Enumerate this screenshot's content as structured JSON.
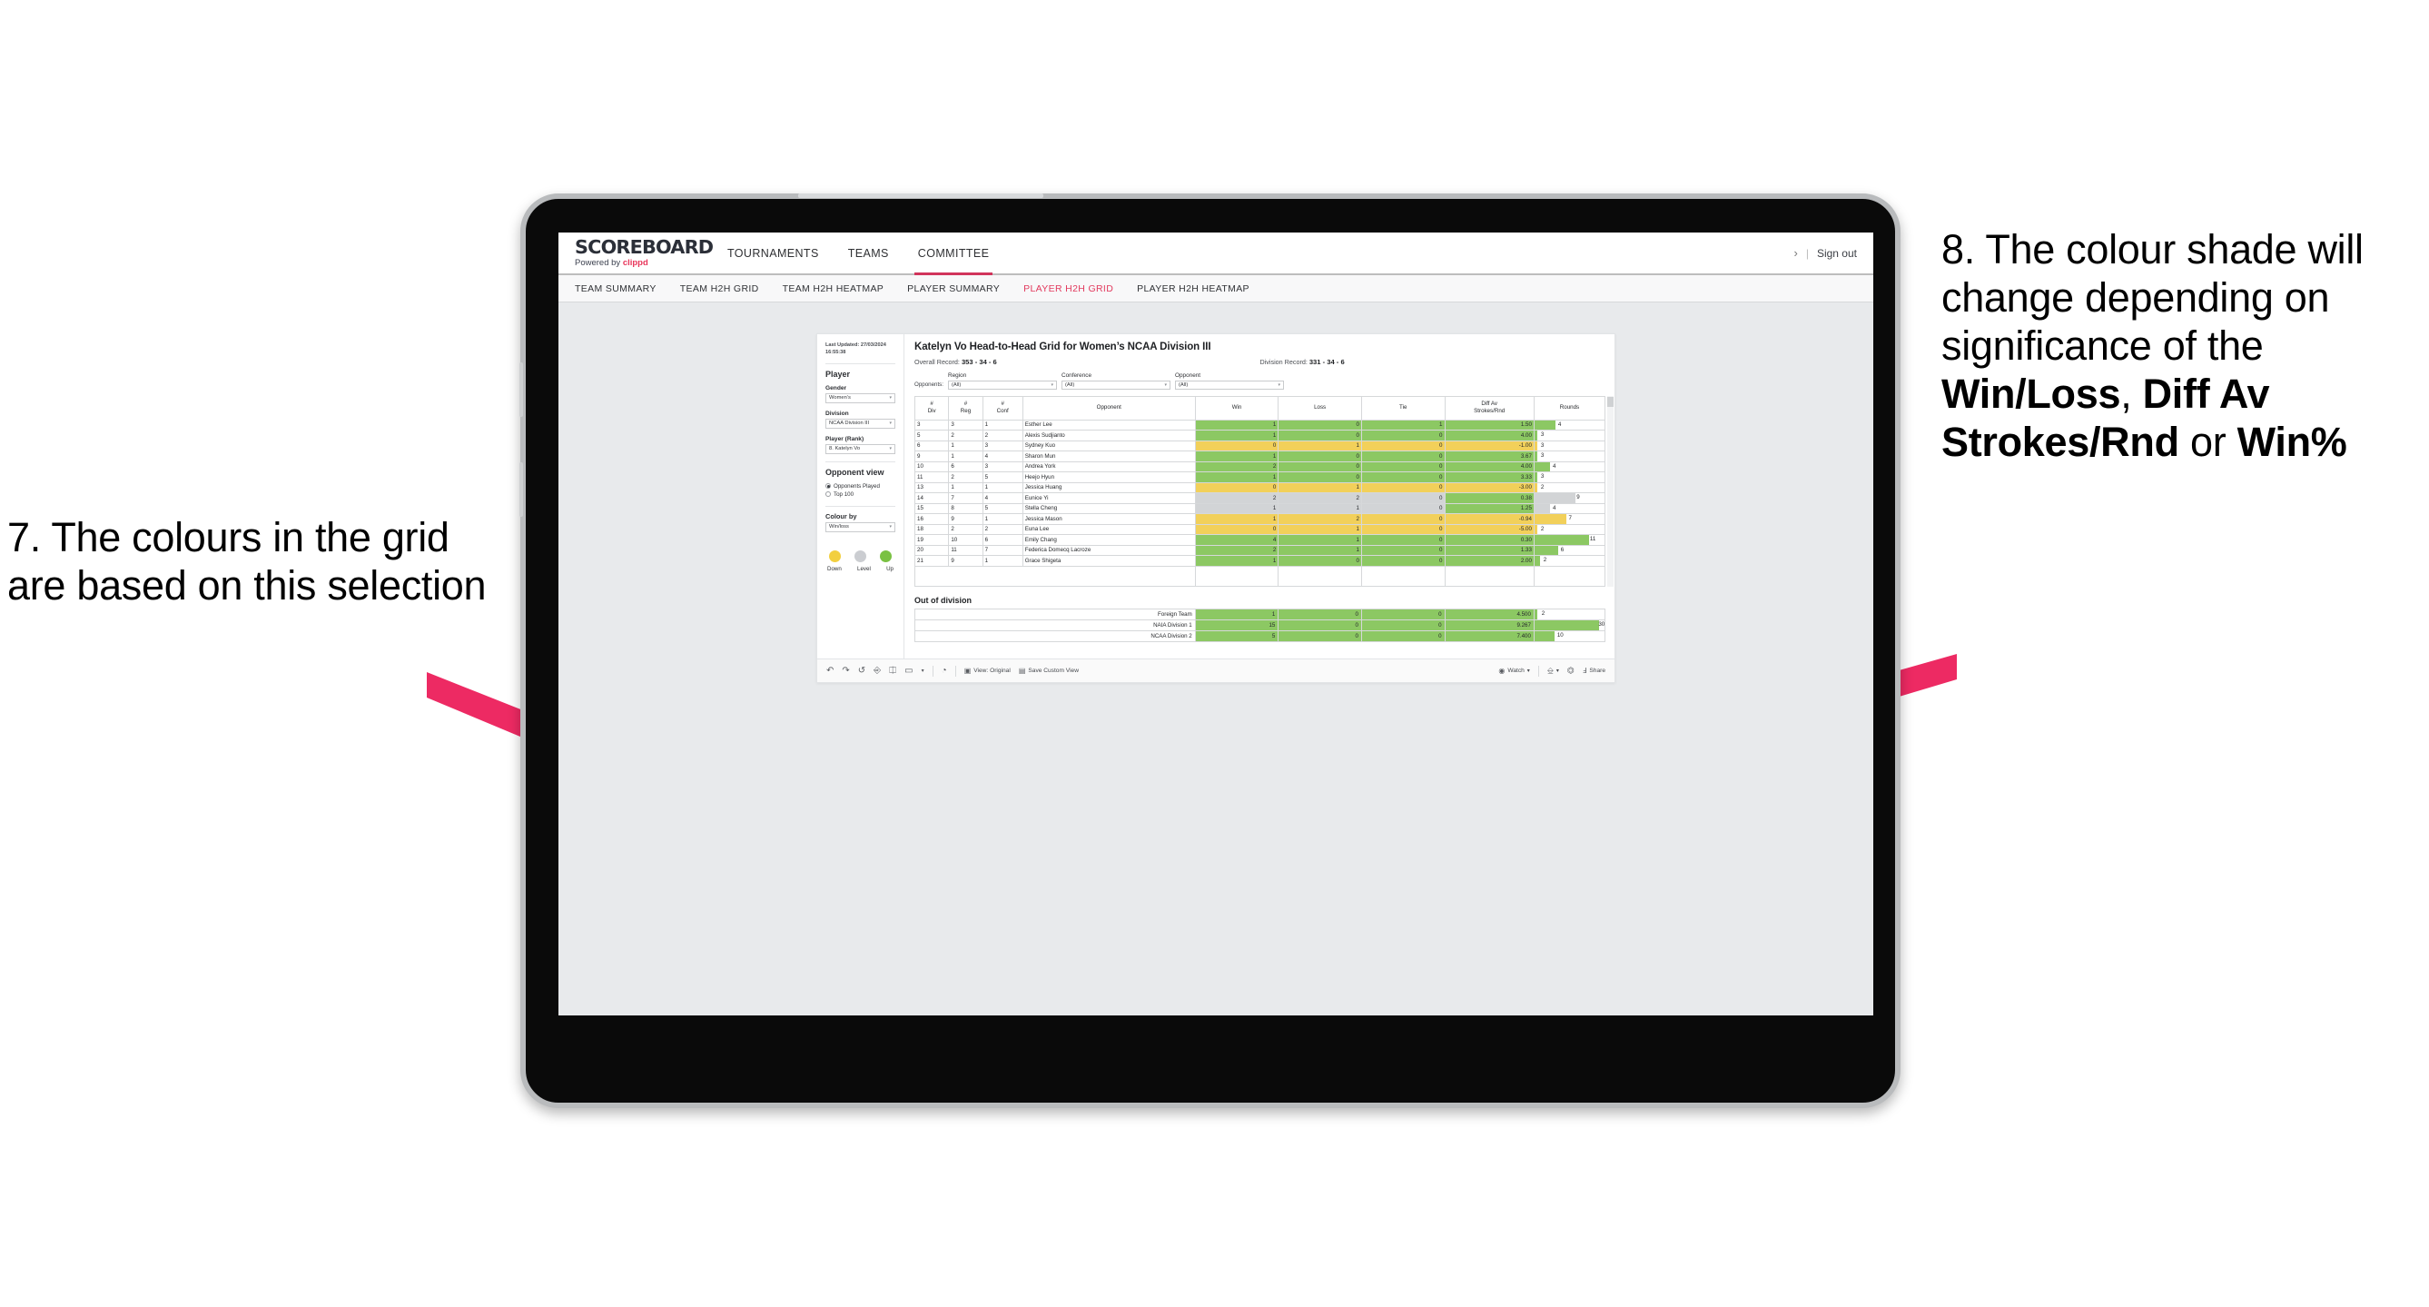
{
  "annotations": {
    "left": {
      "number": "7.",
      "text": "The colours in the grid are based on this selection"
    },
    "right": {
      "number": "8.",
      "part1": "The colour shade will change depending on significance of the ",
      "bold1": "Win/Loss",
      "mid1": ", ",
      "bold2": "Diff Av Strokes/Rnd",
      "mid2": " or ",
      "bold3": "Win%"
    },
    "arrow_color": "#ed2a63"
  },
  "app": {
    "brand": {
      "name": "SCOREBOARD",
      "powered_prefix": "Powered by ",
      "powered_brand": "clippd"
    },
    "topnav": [
      {
        "label": "TOURNAMENTS",
        "active": false
      },
      {
        "label": "TEAMS",
        "active": false
      },
      {
        "label": "COMMITTEE",
        "active": true
      }
    ],
    "topnav_right": {
      "chevron": "›",
      "separator": "|",
      "signout": "Sign out"
    },
    "subnav": [
      {
        "label": "TEAM SUMMARY",
        "active": false
      },
      {
        "label": "TEAM H2H GRID",
        "active": false
      },
      {
        "label": "TEAM H2H HEATMAP",
        "active": false
      },
      {
        "label": "PLAYER SUMMARY",
        "active": false
      },
      {
        "label": "PLAYER H2H GRID",
        "active": true
      },
      {
        "label": "PLAYER H2H HEATMAP",
        "active": false
      }
    ]
  },
  "sidepanel": {
    "last_updated_label": "Last Updated: 27/03/2024",
    "last_updated_time": "16:55:38",
    "section_player": "Player",
    "gender_label": "Gender",
    "gender_value": "Women’s",
    "division_label": "Division",
    "division_value": "NCAA Division III",
    "player_rank_label": "Player (Rank)",
    "player_rank_value": "8. Katelyn Vo",
    "opponent_view_label": "Opponent view",
    "opponent_view_options": [
      {
        "label": "Opponents Played",
        "selected": true
      },
      {
        "label": "Top 100",
        "selected": false
      }
    ],
    "colour_by_label": "Colour by",
    "colour_by_value": "Win/loss",
    "legend": [
      {
        "label": "Down",
        "color": "#f2cf3f"
      },
      {
        "label": "Level",
        "color": "#cbcdd1"
      },
      {
        "label": "Up",
        "color": "#7ac143"
      }
    ]
  },
  "grid": {
    "title": "Katelyn Vo Head-to-Head Grid for Women’s NCAA Division III",
    "overall_record_label": "Overall Record:",
    "overall_record_value": "353 -  34 - 6",
    "division_record_label": "Division Record:",
    "division_record_value": "331 -  34 - 6",
    "opponents_label": "Opponents:",
    "filters": [
      {
        "label": "Region",
        "value": "(All)"
      },
      {
        "label": "Conference",
        "value": "(All)"
      },
      {
        "label": "Opponent",
        "value": "(All)"
      }
    ],
    "columns": [
      {
        "l1": "#",
        "l2": "Div"
      },
      {
        "l1": "#",
        "l2": "Reg"
      },
      {
        "l1": "#",
        "l2": "Conf"
      },
      {
        "l1": "Opponent",
        "l2": ""
      },
      {
        "l1": "Win",
        "l2": ""
      },
      {
        "l1": "Loss",
        "l2": ""
      },
      {
        "l1": "Tie",
        "l2": ""
      },
      {
        "l1": "Diff Av",
        "l2": "Strokes/Rnd"
      },
      {
        "l1": "Rounds",
        "l2": ""
      }
    ],
    "rows": [
      {
        "div": "3",
        "reg": "3",
        "conf": "1",
        "opponent": "Esther Lee",
        "win": "1",
        "loss": "0",
        "tie": "1",
        "diff": "1.50",
        "rounds": "4",
        "color": "#8cc863",
        "bar_pct": 30
      },
      {
        "div": "5",
        "reg": "2",
        "conf": "2",
        "opponent": "Alexis Sudjianto",
        "win": "1",
        "loss": "0",
        "tie": "0",
        "diff": "4.00",
        "rounds": "3",
        "color": "#8cc863",
        "bar_pct": 4
      },
      {
        "div": "6",
        "reg": "1",
        "conf": "3",
        "opponent": "Sydney Kuo",
        "win": "0",
        "loss": "1",
        "tie": "0",
        "diff": "-1.00",
        "rounds": "3",
        "color": "#f2d05a",
        "bar_pct": 4
      },
      {
        "div": "9",
        "reg": "1",
        "conf": "4",
        "opponent": "Sharon Mun",
        "win": "1",
        "loss": "0",
        "tie": "0",
        "diff": "3.67",
        "rounds": "3",
        "color": "#8cc863",
        "bar_pct": 4
      },
      {
        "div": "10",
        "reg": "6",
        "conf": "3",
        "opponent": "Andrea York",
        "win": "2",
        "loss": "0",
        "tie": "0",
        "diff": "4.00",
        "rounds": "4",
        "color": "#8cc863",
        "bar_pct": 22
      },
      {
        "div": "11",
        "reg": "2",
        "conf": "5",
        "opponent": "Heejo Hyun",
        "win": "1",
        "loss": "0",
        "tie": "0",
        "diff": "3.33",
        "rounds": "3",
        "color": "#8cc863",
        "bar_pct": 4
      },
      {
        "div": "13",
        "reg": "1",
        "conf": "1",
        "opponent": "Jessica Huang",
        "win": "0",
        "loss": "1",
        "tie": "0",
        "diff": "-3.00",
        "rounds": "2",
        "color": "#f2d05a",
        "bar_pct": 4
      },
      {
        "div": "14",
        "reg": "7",
        "conf": "4",
        "opponent": "Eunice Yi",
        "win": "2",
        "loss": "2",
        "tie": "0",
        "diff": "0.38",
        "rounds": "9",
        "color": "#d2d4d6",
        "bar_pct": 58,
        "diff_color": "#8cc863"
      },
      {
        "div": "15",
        "reg": "8",
        "conf": "5",
        "opponent": "Stella Cheng",
        "win": "1",
        "loss": "1",
        "tie": "0",
        "diff": "1.25",
        "rounds": "4",
        "color": "#d2d4d6",
        "bar_pct": 22,
        "diff_color": "#8cc863"
      },
      {
        "div": "16",
        "reg": "9",
        "conf": "1",
        "opponent": "Jessica Mason",
        "win": "1",
        "loss": "2",
        "tie": "0",
        "diff": "-0.94",
        "rounds": "7",
        "color": "#f2d05a",
        "bar_pct": 46
      },
      {
        "div": "18",
        "reg": "2",
        "conf": "2",
        "opponent": "Euna Lee",
        "win": "0",
        "loss": "1",
        "tie": "0",
        "diff": "-5.00",
        "rounds": "2",
        "color": "#f2d05a",
        "bar_pct": 4
      },
      {
        "div": "19",
        "reg": "10",
        "conf": "6",
        "opponent": "Emily Chang",
        "win": "4",
        "loss": "1",
        "tie": "0",
        "diff": "0.30",
        "rounds": "11",
        "color": "#8cc863",
        "bar_pct": 78
      },
      {
        "div": "20",
        "reg": "11",
        "conf": "7",
        "opponent": "Federica Domecq Lacroze",
        "win": "2",
        "loss": "1",
        "tie": "0",
        "diff": "1.33",
        "rounds": "6",
        "color": "#8cc863",
        "bar_pct": 34
      }
    ],
    "partial_row": {
      "div": "21",
      "reg": "9",
      "conf": "1",
      "opponent": "Grace Shigeta",
      "win": "1",
      "loss": "0",
      "tie": "0",
      "diff": "2.00",
      "rounds": "2",
      "color": "#8cc863",
      "bar_pct": 8
    },
    "out_of_division_title": "Out of division",
    "out_of_division_rows": [
      {
        "name": "Foreign Team",
        "win": "1",
        "loss": "0",
        "tie": "0",
        "diff": "4.500",
        "rounds": "2",
        "color": "#8cc863",
        "bar_pct": 4
      },
      {
        "name": "NAIA Division 1",
        "win": "15",
        "loss": "0",
        "tie": "0",
        "diff": "9.267",
        "rounds": "30",
        "color": "#8cc863",
        "bar_pct": 92
      },
      {
        "name": "NCAA Division 2",
        "win": "5",
        "loss": "0",
        "tie": "0",
        "diff": "7.400",
        "rounds": "10",
        "color": "#8cc863",
        "bar_pct": 28
      }
    ]
  },
  "toolbar": {
    "undo": "↶",
    "redo": "↷",
    "revert": "↺",
    "refresh": "⭮",
    "pause": "⏸",
    "shape": "▭",
    "caret": "▾",
    "history": "◔",
    "view_label": "View: Original",
    "save_label": "Save Custom View",
    "watch_label": "Watch",
    "watch_caret": "▾",
    "download_caret": "▾",
    "share_label": "Share"
  },
  "chart_data": {
    "type": "table",
    "title": "Katelyn Vo Head-to-Head Grid for Women’s NCAA Division III",
    "columns": [
      "# Div",
      "# Reg",
      "# Conf",
      "Opponent",
      "Win",
      "Loss",
      "Tie",
      "Diff Av Strokes/Rnd",
      "Rounds"
    ],
    "rows": [
      [
        "3",
        "3",
        "1",
        "Esther Lee",
        1,
        0,
        1,
        1.5,
        4
      ],
      [
        "5",
        "2",
        "2",
        "Alexis Sudjianto",
        1,
        0,
        0,
        4.0,
        3
      ],
      [
        "6",
        "1",
        "3",
        "Sydney Kuo",
        0,
        1,
        0,
        -1.0,
        3
      ],
      [
        "9",
        "1",
        "4",
        "Sharon Mun",
        1,
        0,
        0,
        3.67,
        3
      ],
      [
        "10",
        "6",
        "3",
        "Andrea York",
        2,
        0,
        0,
        4.0,
        4
      ],
      [
        "11",
        "2",
        "5",
        "Heejo Hyun",
        1,
        0,
        0,
        3.33,
        3
      ],
      [
        "13",
        "1",
        "1",
        "Jessica Huang",
        0,
        1,
        0,
        -3.0,
        2
      ],
      [
        "14",
        "7",
        "4",
        "Eunice Yi",
        2,
        2,
        0,
        0.38,
        9
      ],
      [
        "15",
        "8",
        "5",
        "Stella Cheng",
        1,
        1,
        0,
        1.25,
        4
      ],
      [
        "16",
        "9",
        "1",
        "Jessica Mason",
        1,
        2,
        0,
        -0.94,
        7
      ],
      [
        "18",
        "2",
        "2",
        "Euna Lee",
        0,
        1,
        0,
        -5.0,
        2
      ],
      [
        "19",
        "10",
        "6",
        "Emily Chang",
        4,
        1,
        0,
        0.3,
        11
      ],
      [
        "20",
        "11",
        "7",
        "Federica Domecq Lacroze",
        2,
        1,
        0,
        1.33,
        6
      ]
    ],
    "out_of_division": [
      [
        "Foreign Team",
        1,
        0,
        0,
        4.5,
        2
      ],
      [
        "NAIA Division 1",
        15,
        0,
        0,
        9.267,
        30
      ],
      [
        "NCAA Division 2",
        5,
        0,
        0,
        7.4,
        10
      ]
    ],
    "colors": {
      "up": "#8cc863",
      "down": "#f2d05a",
      "level": "#d2d4d6"
    }
  }
}
